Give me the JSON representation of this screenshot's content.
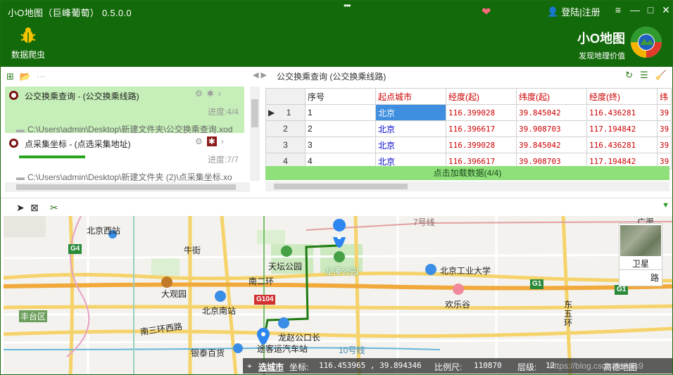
{
  "window": {
    "title": "小O地图（巨峰葡萄） 0.5.0.0",
    "more_dots": "•••",
    "login_label": "登陆|注册",
    "controls": [
      "≡",
      "—",
      "□",
      "✕"
    ]
  },
  "toolbar": {
    "spider_label": "数据爬虫",
    "brand_name": "小O地图",
    "brand_slogan": "发现地理价值"
  },
  "tasks": [
    {
      "name": "公交换乘查询 - (公交换乘线路)",
      "progress": "进度:4/4",
      "path": "C:\\Users\\admin\\Desktop\\新建文件夹\\公交换乘查询.xod",
      "selected": true
    },
    {
      "name": "点采集坐标 - (点选采集地址)",
      "progress": "进度:7/7",
      "path": "C:\\Users\\admin\\Desktop\\新建文件夹 (2)\\点采集坐标.xo",
      "selected": false
    }
  ],
  "grid": {
    "breadcrumb": "公交换乘查询 (公交换乘线路)",
    "columns": [
      "序号",
      "起点城市",
      "经度(起)",
      "纬度(起)",
      "经度(终)",
      "纬"
    ],
    "rows": [
      {
        "row": "1",
        "seq": "1",
        "city": "北京",
        "lng_start": "116.399028",
        "lat_start": "39.845042",
        "lng_end": "116.436281",
        "lat_end": "39"
      },
      {
        "row": "2",
        "seq": "2",
        "city": "北京",
        "lng_start": "116.396617",
        "lat_start": "39.908703",
        "lng_end": "117.194842",
        "lat_end": "39"
      },
      {
        "row": "3",
        "seq": "3",
        "city": "北京",
        "lng_start": "116.399028",
        "lat_start": "39.845042",
        "lng_end": "116.436281",
        "lat_end": "39"
      },
      {
        "row": "4",
        "seq": "4",
        "city": "北京",
        "lng_start": "116.396617",
        "lat_start": "39.908703",
        "lng_end": "117.194842",
        "lat_end": "39"
      }
    ],
    "load_button": "点击加载数据(4/4)"
  },
  "map": {
    "labels": {
      "beijing_west": "北京西站",
      "niujie": "牛街",
      "tiantan": "天坛公园",
      "longtan": "龙潭公园",
      "bjut": "北京工业大学",
      "daguanyuan": "大观园",
      "nanerhuan": "南二环",
      "beijing_south": "北京南站",
      "happy_valley": "欢乐谷",
      "fengtai": "丰台区",
      "south3": "南三环西路",
      "yintai": "银泰百货",
      "longzhao": "龙赵公口长",
      "bus_station": "途客运汽车站",
      "dongwu": "东\n五\n环",
      "guangqu": "广渠",
      "line7": "7号线",
      "line10": "10号线",
      "g4": "G4",
      "g104": "G104",
      "g1a": "G1",
      "g1b": "G1"
    },
    "satellite_label": "卫星",
    "road_label": "路",
    "status": {
      "city": "选城市",
      "coord_label": "坐标:",
      "coord_value": "116.453965 , 39.894346",
      "scale_label": "比例尺:",
      "scale_value": "110870",
      "level_label": "层级:",
      "level_value": "12",
      "source": "高德地图",
      "watermark": "https://blog.csdn.net/gis9"
    }
  },
  "colors": {
    "brand_green": "#136a0a",
    "selected_task": "#c5eeb8",
    "load_bar": "#8fe07a",
    "header_red": "#cc0000",
    "route_green": "#1f7a12",
    "marker_blue": "#2d86f0"
  }
}
